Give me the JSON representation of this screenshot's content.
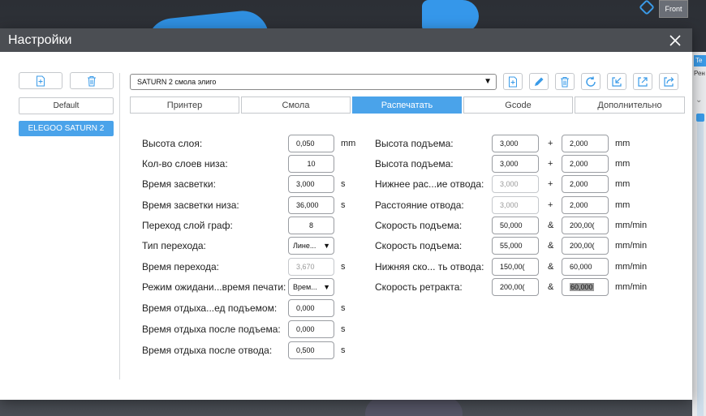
{
  "viewport": {
    "view_label": "Front",
    "right_tab1": "Te",
    "right_tab2": "Рен"
  },
  "dialog": {
    "title": "Настройки"
  },
  "left_panel": {
    "default_label": "Default",
    "printers": [
      "ELEGOO SATURN 2"
    ]
  },
  "profile": {
    "selected": "SATURN 2 смола элиго"
  },
  "tabs": [
    {
      "label": "Принтер",
      "active": false
    },
    {
      "label": "Смола",
      "active": false
    },
    {
      "label": "Распечатать",
      "active": true
    },
    {
      "label": "Gcode",
      "active": false
    },
    {
      "label": "Дополнительно",
      "active": false
    }
  ],
  "left_fields": [
    {
      "label": "Высота слоя:",
      "value": "0,050",
      "unit": "mm"
    },
    {
      "label": "Кол-во слоев низа:",
      "value": "10",
      "unit": ""
    },
    {
      "label": "Время засветки:",
      "value": "3,000",
      "unit": "s"
    },
    {
      "label": "Время засветки низа:",
      "value": "36,000",
      "unit": "s"
    },
    {
      "label": "Переход слой граф:",
      "value": "8",
      "unit": ""
    },
    {
      "label": "Тип перехода:",
      "value": "Лине...",
      "unit": ""
    },
    {
      "label": "Время перехода:",
      "value": "3,670",
      "unit": "s"
    },
    {
      "label": "Режим ожидани...время печати:",
      "value": "Врем...",
      "unit": ""
    },
    {
      "label": "Время отдыха...ед подъемом:",
      "value": "0,000",
      "unit": "s"
    },
    {
      "label": "Время отдыха после подъема:",
      "value": "0,000",
      "unit": "s"
    },
    {
      "label": "Время отдыха после отвода:",
      "value": "0,500",
      "unit": "s"
    }
  ],
  "right_fields": [
    {
      "label": "Высота подъема:",
      "value1": "3,000",
      "sym": "+",
      "value2": "2,000",
      "unit": "mm"
    },
    {
      "label": "Высота подъема:",
      "value1": "3,000",
      "sym": "+",
      "value2": "2,000",
      "unit": "mm"
    },
    {
      "label": "Нижнее рас...ие отвода:",
      "value1": "3,000",
      "sym": "+",
      "value2": "2,000",
      "unit": "mm"
    },
    {
      "label": "Расстояние отвода:",
      "value1": "3,000",
      "sym": "+",
      "value2": "2,000",
      "unit": "mm"
    },
    {
      "label": "Скорость подъема:",
      "value1": "50,000",
      "sym": "&",
      "value2": "200,00(",
      "unit": "mm/min"
    },
    {
      "label": "Скорость подъема:",
      "value1": "55,000",
      "sym": "&",
      "value2": "200,00(",
      "unit": "mm/min"
    },
    {
      "label": "Нижняя ско... ть отвода:",
      "value1": "150,00(",
      "sym": "&",
      "value2": "60,000",
      "unit": "mm/min"
    },
    {
      "label": "Скорость ретракта:",
      "value1": "200,00(",
      "sym": "&",
      "value2": "60,000",
      "unit": "mm/min"
    }
  ]
}
